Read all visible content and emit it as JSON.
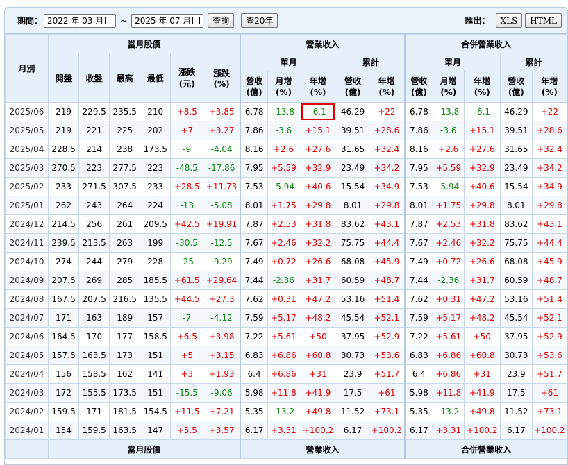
{
  "toolbar": {
    "period_label": "期間：",
    "start_date": "2022 年 03 月",
    "tilde": "~",
    "end_date": "2025 年 07 月",
    "query_button": "查詢",
    "query20_button": "查20年",
    "export_label": "匯出：",
    "xls_button": "XLS",
    "html_button": "HTML"
  },
  "header": {
    "month": "月別",
    "stock_group": "當月股價",
    "revenue_group": "營業收入",
    "consolidated_group": "合併營業收入",
    "monthly": "單月",
    "cumulative": "累計",
    "open": "開盤",
    "close": "收盤",
    "high": "最高",
    "low": "最低",
    "change_1": "漲跌",
    "change_1_unit": "(元)",
    "change_2": "漲跌",
    "change_2_unit": "(%)",
    "rev_1": "營收",
    "rev_1_unit": "(億)",
    "mom_1": "月增",
    "mom_1_unit": "(%)",
    "yoy_1": "年增",
    "yoy_1_unit": "(%)",
    "rev_2": "營收",
    "rev_2_unit": "(億)",
    "yoy_2": "年增",
    "yoy_2_unit": "(%)",
    "rev_3": "營收",
    "rev_3_unit": "(億)",
    "mom_3": "月增",
    "mom_3_unit": "(%)",
    "yoy_3": "年增",
    "yoy_3_unit": "(%)",
    "rev_4": "營收",
    "rev_4_unit": "(億)",
    "yoy_4": "年增",
    "yoy_4_unit": "(%)"
  },
  "footer": {
    "stock_group": "當月股價",
    "revenue_group": "營業收入",
    "consolidated_group": "合併營業收入"
  },
  "colors": {
    "positive": "#e00000",
    "negative": "#098b09",
    "highlight": "#e00000"
  },
  "rows": [
    [
      "2025/06",
      "219",
      "229.5",
      "235.5",
      "210",
      "+8.5",
      "+3.85",
      "6.78",
      "-13.8",
      "-6.1",
      "46.29",
      "+22",
      "6.78",
      "-13.8",
      "-6.1",
      "46.29",
      "+22"
    ],
    [
      "2025/05",
      "219",
      "221",
      "225",
      "202",
      "+7",
      "+3.27",
      "7.86",
      "-3.6",
      "+15.1",
      "39.51",
      "+28.6",
      "7.86",
      "-3.6",
      "+15.1",
      "39.51",
      "+28.6"
    ],
    [
      "2025/04",
      "228.5",
      "214",
      "238",
      "173.5",
      "-9",
      "-4.04",
      "8.16",
      "+2.6",
      "+27.6",
      "31.65",
      "+32.4",
      "8.16",
      "+2.6",
      "+27.6",
      "31.65",
      "+32.4"
    ],
    [
      "2025/03",
      "270.5",
      "223",
      "277.5",
      "223",
      "-48.5",
      "-17.86",
      "7.95",
      "+5.59",
      "+32.9",
      "23.49",
      "+34.2",
      "7.95",
      "+5.59",
      "+32.9",
      "23.49",
      "+34.2"
    ],
    [
      "2025/02",
      "233",
      "271.5",
      "307.5",
      "233",
      "+28.5",
      "+11.73",
      "7.53",
      "-5.94",
      "+40.6",
      "15.54",
      "+34.9",
      "7.53",
      "-5.94",
      "+40.6",
      "15.54",
      "+34.9"
    ],
    [
      "2025/01",
      "262",
      "243",
      "264",
      "224",
      "-13",
      "-5.08",
      "8.01",
      "+1.75",
      "+29.8",
      "8.01",
      "+29.8",
      "8.01",
      "+1.75",
      "+29.8",
      "8.01",
      "+29.8"
    ],
    [
      "2024/12",
      "214.5",
      "256",
      "261",
      "209.5",
      "+42.5",
      "+19.91",
      "7.87",
      "+2.53",
      "+31.8",
      "83.62",
      "+43.1",
      "7.87",
      "+2.53",
      "+31.8",
      "83.62",
      "+43.1"
    ],
    [
      "2024/11",
      "239.5",
      "213.5",
      "263",
      "199",
      "-30.5",
      "-12.5",
      "7.67",
      "+2.46",
      "+32.2",
      "75.75",
      "+44.4",
      "7.67",
      "+2.46",
      "+32.2",
      "75.75",
      "+44.4"
    ],
    [
      "2024/10",
      "274",
      "244",
      "279",
      "228",
      "-25",
      "-9.29",
      "7.49",
      "+0.72",
      "+26.6",
      "68.08",
      "+45.9",
      "7.49",
      "+0.72",
      "+26.6",
      "68.08",
      "+45.9"
    ],
    [
      "2024/09",
      "207.5",
      "269",
      "285",
      "185.5",
      "+61.5",
      "+29.64",
      "7.44",
      "-2.36",
      "+31.7",
      "60.59",
      "+48.7",
      "7.44",
      "-2.36",
      "+31.7",
      "60.59",
      "+48.7"
    ],
    [
      "2024/08",
      "167.5",
      "207.5",
      "216.5",
      "135.5",
      "+44.5",
      "+27.3",
      "7.62",
      "+0.31",
      "+47.2",
      "53.16",
      "+51.4",
      "7.62",
      "+0.31",
      "+47.2",
      "53.16",
      "+51.4"
    ],
    [
      "2024/07",
      "171",
      "163",
      "189",
      "157",
      "-7",
      "-4.12",
      "7.59",
      "+5.17",
      "+48.2",
      "45.54",
      "+52.1",
      "7.59",
      "+5.17",
      "+48.2",
      "45.54",
      "+52.1"
    ],
    [
      "2024/06",
      "164.5",
      "170",
      "177",
      "158.5",
      "+6.5",
      "+3.98",
      "7.22",
      "+5.61",
      "+50",
      "37.95",
      "+52.9",
      "7.22",
      "+5.61",
      "+50",
      "37.95",
      "+52.9"
    ],
    [
      "2024/05",
      "157.5",
      "163.5",
      "173",
      "151",
      "+5",
      "+3.15",
      "6.83",
      "+6.86",
      "+60.8",
      "30.73",
      "+53.6",
      "6.83",
      "+6.86",
      "+60.8",
      "30.73",
      "+53.6"
    ],
    [
      "2024/04",
      "156",
      "158.5",
      "162",
      "141",
      "+3",
      "+1.93",
      "6.4",
      "+6.86",
      "+31",
      "23.9",
      "+51.7",
      "6.4",
      "+6.86",
      "+31",
      "23.9",
      "+51.7"
    ],
    [
      "2024/03",
      "172",
      "155.5",
      "173.5",
      "151",
      "-15.5",
      "-9.06",
      "5.98",
      "+11.8",
      "+41.9",
      "17.5",
      "+61",
      "5.98",
      "+11.8",
      "+41.9",
      "17.5",
      "+61"
    ],
    [
      "2024/02",
      "159.5",
      "171",
      "181.5",
      "154.5",
      "+11.5",
      "+7.21",
      "5.35",
      "-13.2",
      "+49.8",
      "11.52",
      "+73.1",
      "5.35",
      "-13.2",
      "+49.8",
      "11.52",
      "+73.1"
    ],
    [
      "2024/01",
      "154",
      "159.5",
      "163.5",
      "147",
      "+5.5",
      "+3.57",
      "6.17",
      "+3.31",
      "+100.2",
      "6.17",
      "+100.2",
      "6.17",
      "+3.31",
      "+100.2",
      "6.17",
      "+100.2"
    ]
  ]
}
